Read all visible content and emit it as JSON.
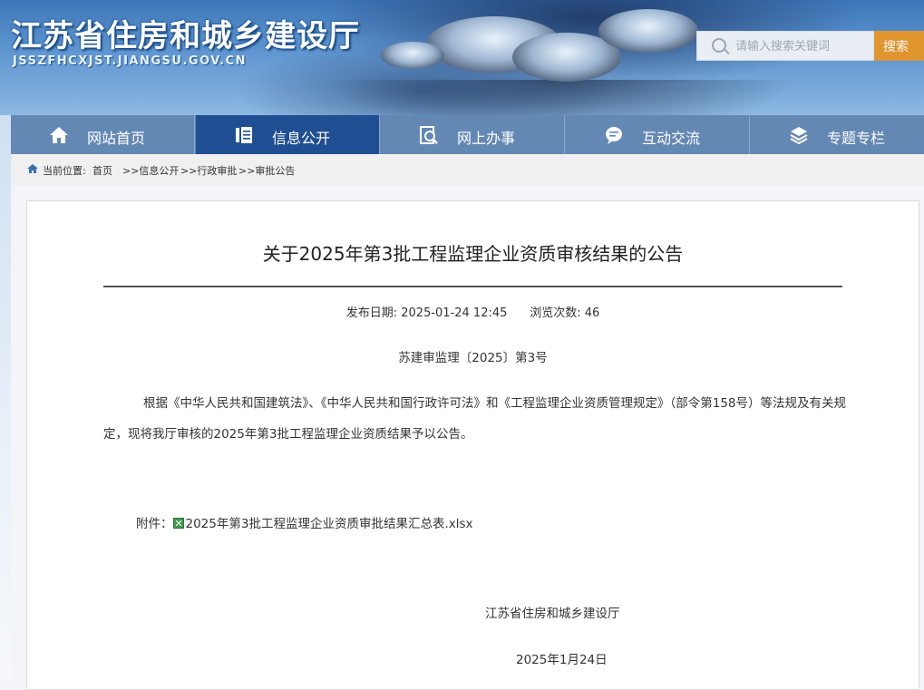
{
  "header": {
    "site_title": "江苏省住房和城乡建设厅",
    "site_domain": "JSSZFHCXJST.JIANGSU.GOV.CN",
    "search_placeholder": "请输入搜索关键词",
    "search_button": "搜索"
  },
  "nav": {
    "items": [
      {
        "label": "网站首页",
        "icon": "home-icon"
      },
      {
        "label": "信息公开",
        "icon": "document-icon",
        "active": true
      },
      {
        "label": "网上办事",
        "icon": "search-document-icon"
      },
      {
        "label": "互动交流",
        "icon": "chat-icon"
      },
      {
        "label": "专题专栏",
        "icon": "layers-icon"
      }
    ]
  },
  "breadcrumb": {
    "prefix": "当前位置:",
    "items": [
      "首页",
      ">>信息公开",
      ">>行政审批",
      ">>审批公告"
    ]
  },
  "article": {
    "title": "关于2025年第3批工程监理企业资质审核结果的公告",
    "publish_label": "发布日期:",
    "publish_date": "2025-01-24 12:45",
    "views_label": "浏览次数:",
    "views": "46",
    "doc_number": "苏建审监理〔2025〕第3号",
    "body": "根据《中华人民共和国建筑法》、《中华人民共和国行政许可法》和《工程监理企业资质管理规定》（部令第158号）等法规及有关规定，现将我厅审核的2025年第3批工程监理企业资质结果予以公告。",
    "attachment_label": "附件：",
    "attachment_file": "2025年第3批工程监理企业资质审批结果汇总表.xlsx",
    "signature": "江苏省住房和城乡建设厅",
    "sign_date": "2025年1月24日"
  },
  "colors": {
    "nav_bg": "#6488b4",
    "nav_active": "#1f4f92",
    "search_button": "#e0952e"
  }
}
